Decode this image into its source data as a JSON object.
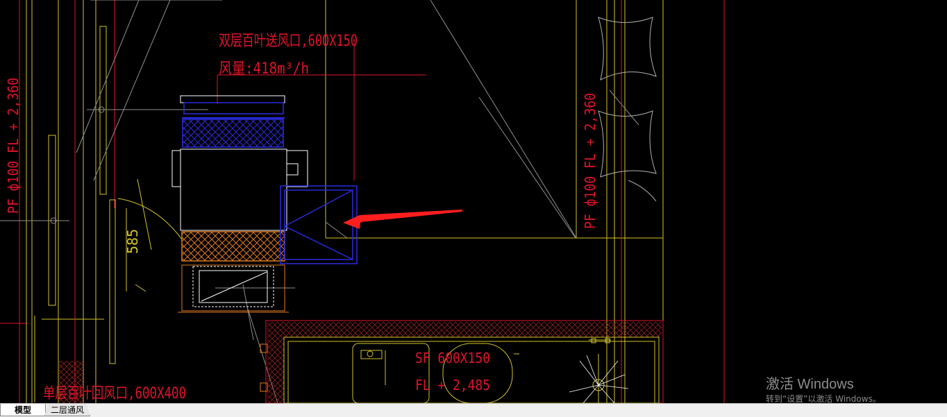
{
  "drawing": {
    "supply_vent_label": "双层百叶送风口,600X150",
    "airflow_label": "风量:418m³/h",
    "pipe_label_left": "PF ф100 FL + 2,360",
    "pipe_label_right": "PF ф100 FL + 2,360",
    "dimension_label": "585",
    "sf_label": "SF 600X150",
    "fl_label": "FL + 2,485",
    "return_vent_label": "单层百叶回风口,600X400",
    "colors": {
      "red": "#e0142a",
      "yellow": "#d4c42a",
      "blue": "#2020e0",
      "white": "#ffffff",
      "orange": "#e07a20",
      "annotation_arrow": "#ff1e1e"
    }
  },
  "watermark": {
    "title": "激活 Windows",
    "subtitle": "转到“设置”以激活 Windows。"
  },
  "tabs": [
    {
      "label": "模型",
      "active": true
    },
    {
      "label": "二层通风",
      "active": false
    }
  ]
}
